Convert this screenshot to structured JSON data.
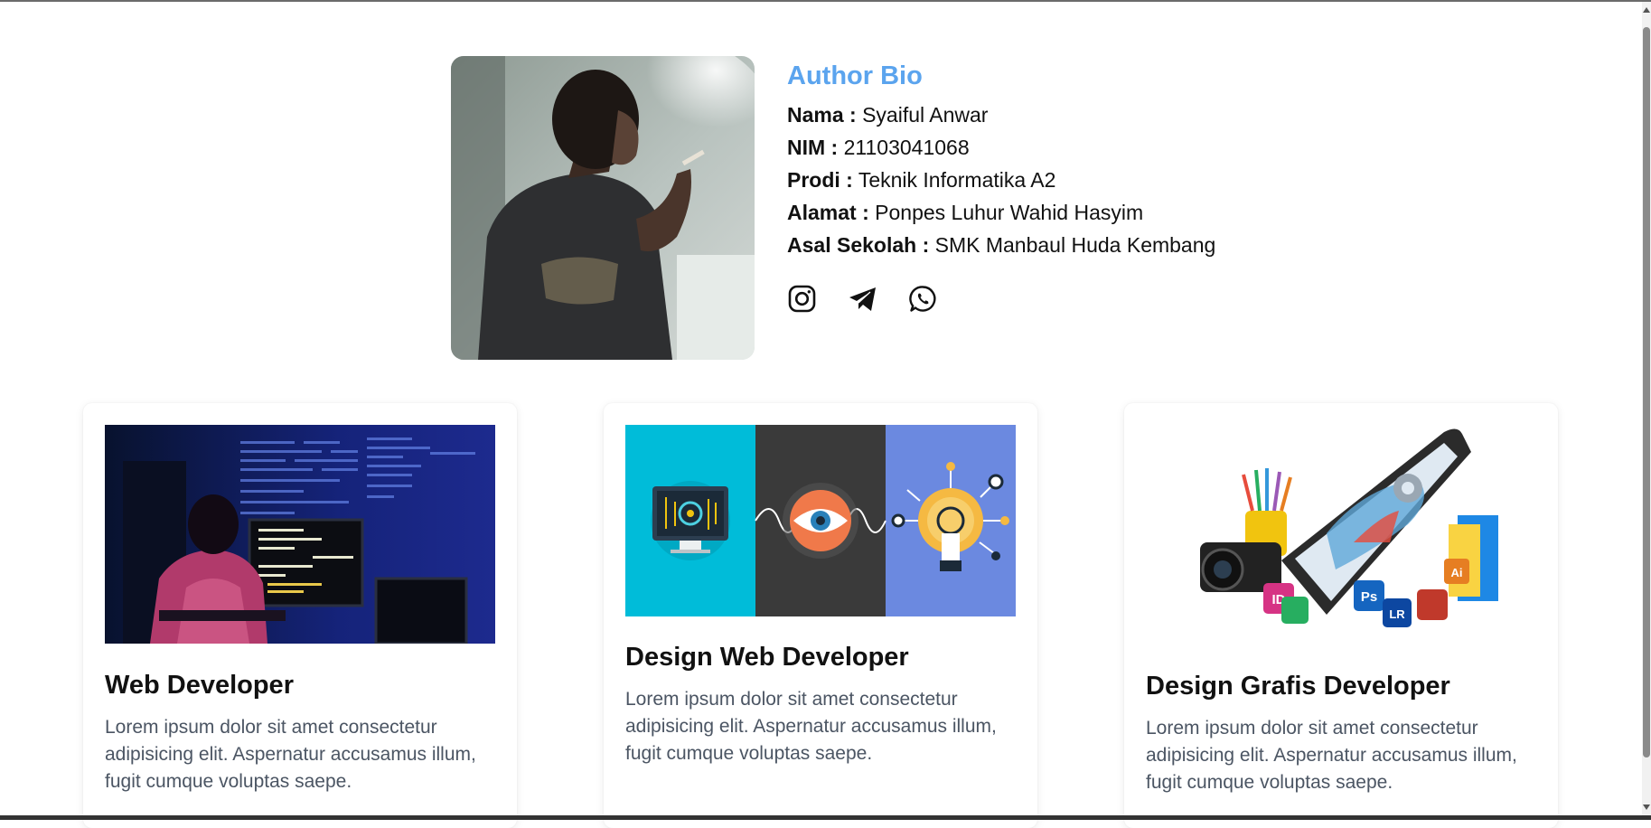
{
  "bio": {
    "title": "Author Bio",
    "rows": [
      {
        "label": "Nama :",
        "value": "Syaiful Anwar"
      },
      {
        "label": "NIM :",
        "value": "21103041068"
      },
      {
        "label": "Prodi :",
        "value": "Teknik Informatika A2"
      },
      {
        "label": "Alamat :",
        "value": "Ponpes Luhur Wahid Hasyim"
      },
      {
        "label": "Asal Sekolah :",
        "value": "SMK Manbaul Huda Kembang"
      }
    ],
    "socials": [
      "instagram-icon",
      "telegram-icon",
      "whatsapp-icon"
    ]
  },
  "cards": [
    {
      "title": "Web Developer",
      "text": "Lorem ipsum dolor sit amet consectetur adipisicing elit. Aspernatur accusamus illum, fugit cumque voluptas saepe."
    },
    {
      "title": "Design Web Developer",
      "text": "Lorem ipsum dolor sit amet consectetur adipisicing elit. Aspernatur accusamus illum, fugit cumque voluptas saepe."
    },
    {
      "title": "Design Grafis Developer",
      "text": "Lorem ipsum dolor sit amet consectetur adipisicing elit. Aspernatur accusamus illum, fugit cumque voluptas saepe.",
      "image_badges": [
        "ID",
        "Ps",
        "LR",
        "Ai"
      ]
    }
  ],
  "colors": {
    "accent": "#5ba4ee",
    "body_text": "#4b5563",
    "panel_cyan": "#00bcd9",
    "panel_dark": "#3a3a3a",
    "panel_blue": "#6b89e0"
  }
}
